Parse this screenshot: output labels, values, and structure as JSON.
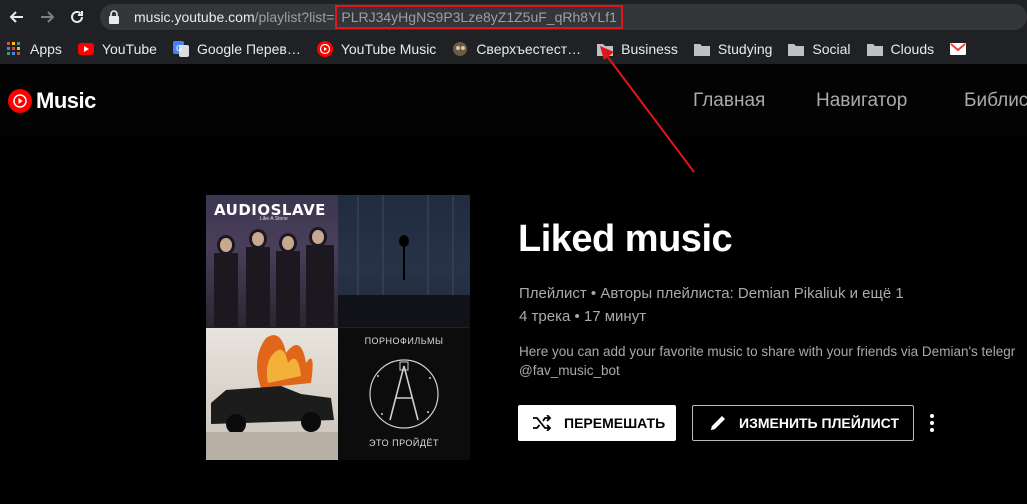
{
  "browser": {
    "url_host": "music.youtube.com",
    "url_path": "/playlist?list=",
    "url_param": "PLRJ34yHgNS9P3Lze8yZ1Z5uF_qRh8YLf1"
  },
  "bookmarks": [
    {
      "label": "Apps",
      "icon": "apps-grid-icon"
    },
    {
      "label": "YouTube",
      "icon": "youtube-icon"
    },
    {
      "label": "Google Перев…",
      "icon": "google-translate-icon"
    },
    {
      "label": "YouTube Music",
      "icon": "youtube-music-icon"
    },
    {
      "label": "Сверхъестест…",
      "icon": "site-icon"
    },
    {
      "label": "Business",
      "icon": "folder-icon"
    },
    {
      "label": "Studying",
      "icon": "folder-icon"
    },
    {
      "label": "Social",
      "icon": "folder-icon"
    },
    {
      "label": "Clouds",
      "icon": "folder-icon"
    }
  ],
  "app": {
    "logo_text": "Music",
    "nav": [
      "Главная",
      "Навигатор",
      "Библис"
    ]
  },
  "cover": {
    "tile1_text": "AUDIOSLAVE",
    "tile1_sub": "Like A Stone",
    "tile4_title": "ПОРНОФИЛЬМЫ",
    "tile4_sub": "ЭТО ПРОЙДЁТ"
  },
  "playlist": {
    "title": "Liked music",
    "meta_line1": "Плейлист • Авторы плейлиста: Demian Pikaliuk и ещё 1",
    "meta_line2": "4 трека • 17 минут",
    "description_line1": "Here you can add your favorite music to share with your friends via Demian's telegr",
    "description_line2": "@fav_music_bot"
  },
  "actions": {
    "shuffle_label": "ПЕРЕМЕШАТЬ",
    "edit_label": "ИЗМЕНИТЬ ПЛЕЙЛИСТ"
  },
  "colors": {
    "brand_red": "#ff0000",
    "annotation_red": "#e0161a"
  }
}
